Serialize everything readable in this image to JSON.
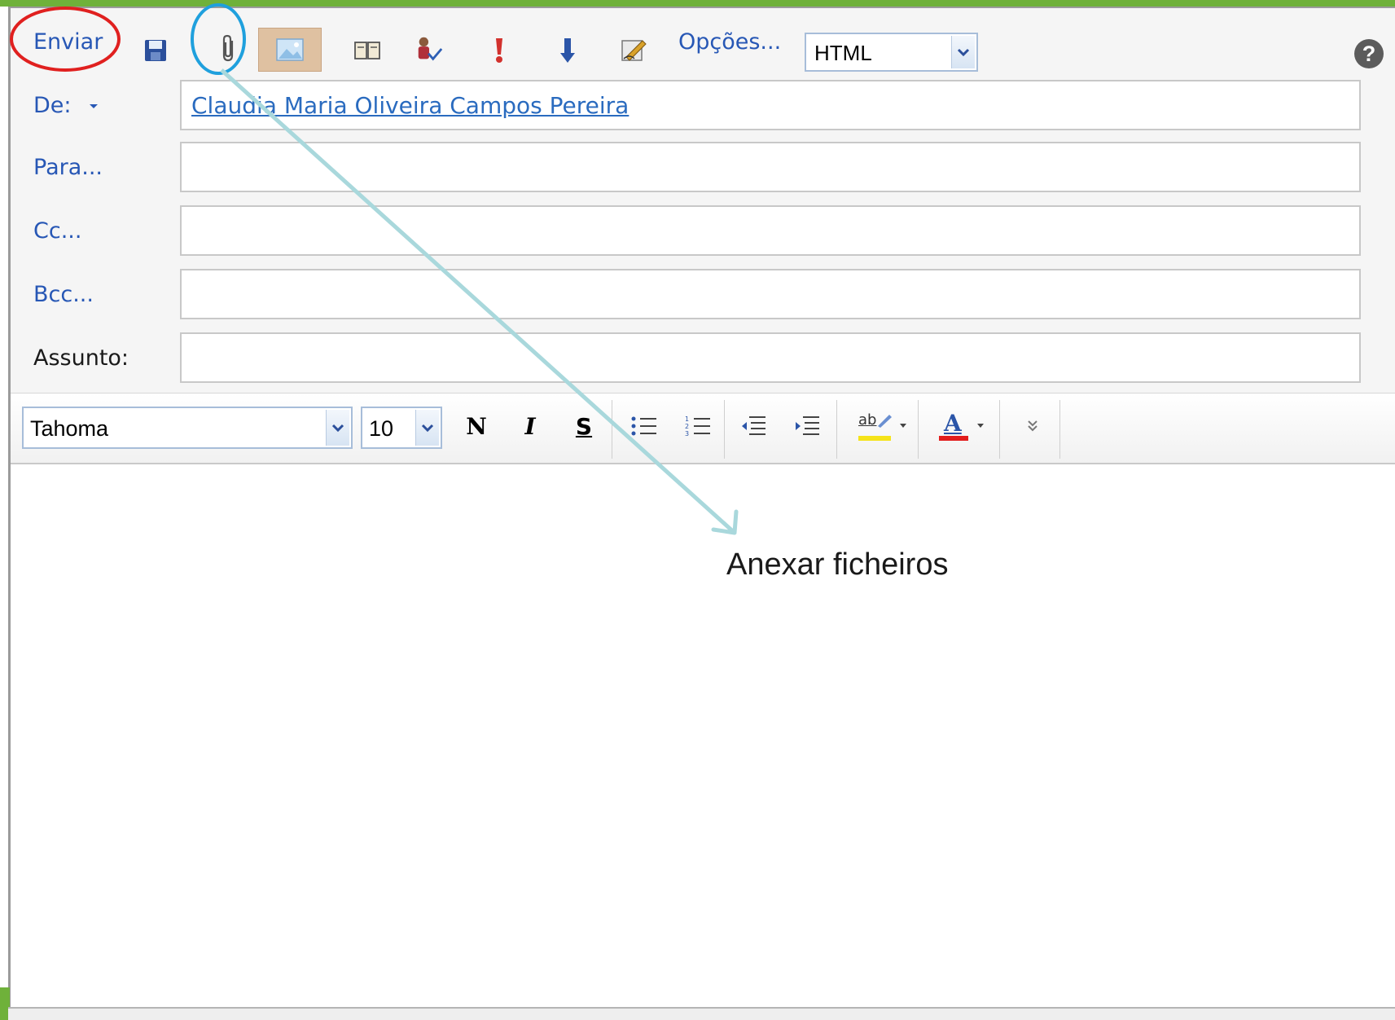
{
  "toolbar": {
    "send_label": "Enviar",
    "options_label": "Opções...",
    "format_select": "HTML",
    "help_glyph": "?"
  },
  "fields": {
    "from_label": "De:",
    "from_value": "Claudia Maria Oliveira Campos Pereira",
    "to_label": "Para...",
    "cc_label": "Cc...",
    "bcc_label": "Bcc...",
    "subject_label": "Assunto:"
  },
  "format_bar": {
    "font_family": "Tahoma",
    "font_size": "10",
    "bold_label": "N",
    "italic_label": "I",
    "underline_label": "S",
    "highlight_label": "ab",
    "font_color_label": "A"
  },
  "annotation": {
    "callout_text": "Anexar ficheiros",
    "send_circle_color": "#e0201f",
    "attach_circle_color": "#1fa0dd",
    "arrow_color": "#a9d8dc"
  },
  "colors": {
    "accent_green": "#6fb13a",
    "link_blue": "#2757b5"
  }
}
